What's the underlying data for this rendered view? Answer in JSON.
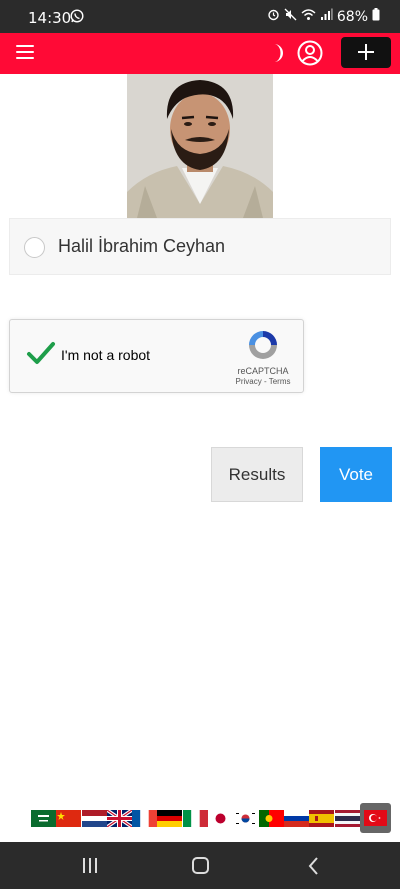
{
  "status_bar": {
    "time": "14:30",
    "battery": "68%"
  },
  "header": {
    "menu_icon": "hamburger-menu-icon",
    "theme_icon": "moon-icon",
    "account_icon": "user-circle-icon",
    "add_icon": "plus-icon",
    "brand_color": "#ff0a36"
  },
  "poll": {
    "option_label": "Halil İbrahim Ceyhan"
  },
  "captcha": {
    "label": "I'm not a robot",
    "brand": "reCAPTCHA",
    "privacy": "Privacy",
    "separator": " - ",
    "terms": "Terms",
    "checked": true
  },
  "actions": {
    "results_label": "Results",
    "vote_label": "Vote",
    "vote_color": "#2196f3"
  },
  "languages": [
    "arabic",
    "chinese",
    "dutch",
    "english",
    "french",
    "german",
    "italian",
    "japanese",
    "korean",
    "portuguese",
    "russian",
    "spanish",
    "thai",
    "turkish"
  ],
  "active_language": "turkish",
  "nav": {
    "recents_icon": "recents-icon",
    "home_icon": "home-icon",
    "back_icon": "back-icon"
  }
}
